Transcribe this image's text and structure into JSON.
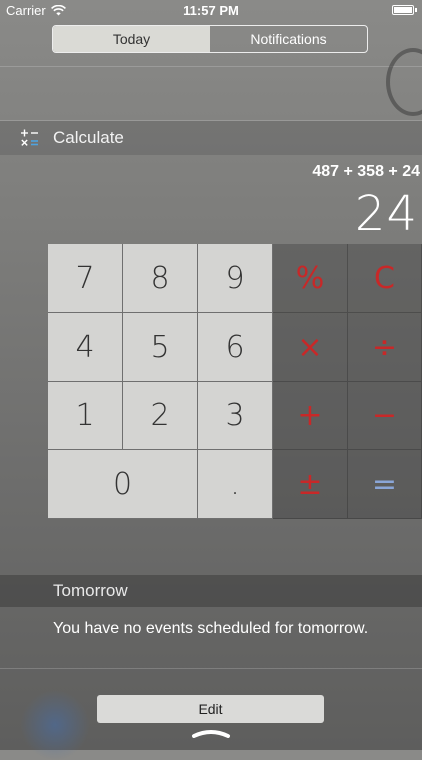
{
  "status_bar": {
    "carrier": "Carrier",
    "time": "11:57 PM"
  },
  "segmented": {
    "tabs": [
      {
        "label": "Today",
        "selected": true
      },
      {
        "label": "Notifications",
        "selected": false
      }
    ]
  },
  "widget": {
    "title": "Calculate",
    "icon": "calculator-icon",
    "expression": "487 + 358 + 24",
    "result": "24"
  },
  "keypad": {
    "digits": [
      "7",
      "8",
      "9",
      "4",
      "5",
      "6",
      "1",
      "2",
      "3",
      "0",
      "."
    ],
    "operators": [
      "%",
      "C",
      "×",
      "÷",
      "+",
      "−",
      "±",
      "="
    ]
  },
  "tomorrow": {
    "title": "Tomorrow",
    "message": "You have no events scheduled for tomorrow."
  },
  "edit_button": {
    "label": "Edit"
  },
  "colors": {
    "operator": "#c82828",
    "equals": "#8aa6d8",
    "key_background": "#d4d4d2"
  }
}
